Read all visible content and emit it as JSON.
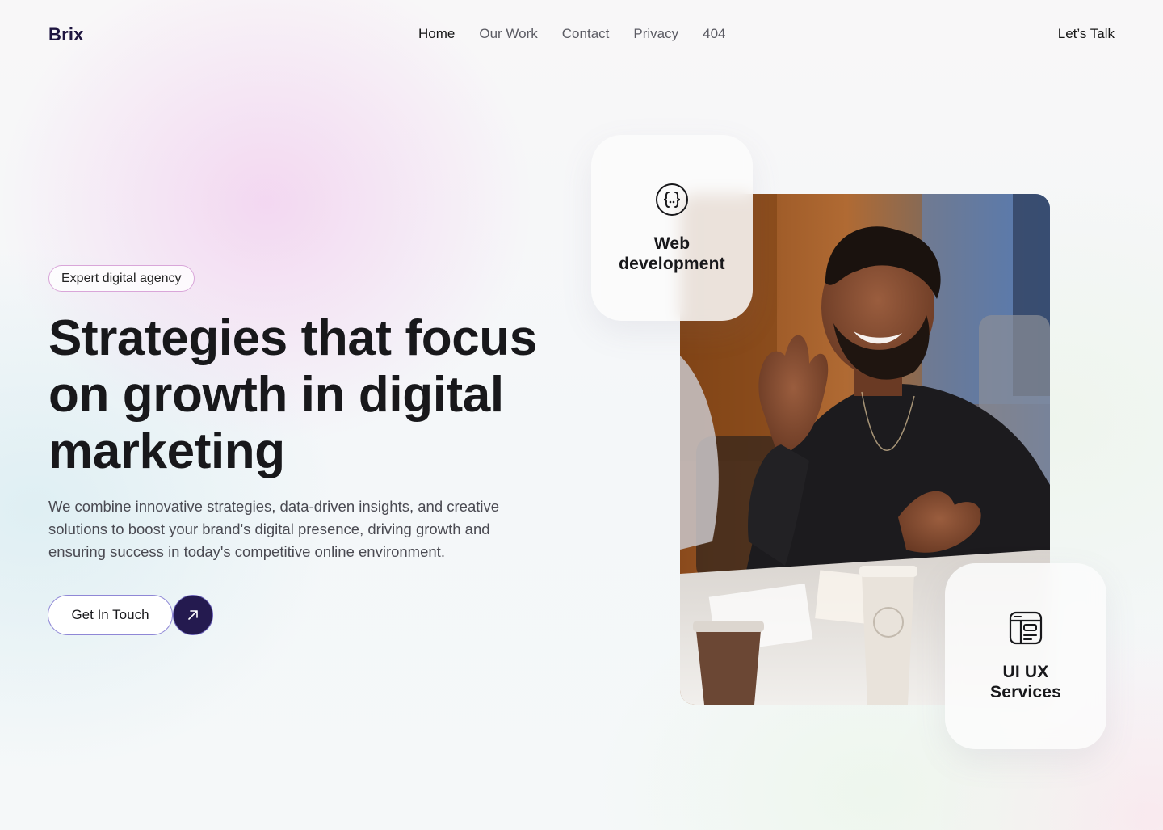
{
  "brand": {
    "name": "Brix"
  },
  "nav": {
    "items": [
      {
        "label": "Home",
        "active": true
      },
      {
        "label": "Our Work",
        "active": false
      },
      {
        "label": "Contact",
        "active": false
      },
      {
        "label": "Privacy",
        "active": false
      },
      {
        "label": "404",
        "active": false
      }
    ],
    "cta": "Let’s Talk"
  },
  "hero": {
    "badge": "Expert digital agency",
    "title_lines": [
      "Strategies that focus",
      "on growth in digital",
      "marketing"
    ],
    "description_lines": [
      "We combine innovative strategies, data-driven insights, and creative",
      "solutions to boost your brand's digital presence, driving growth and",
      "ensuring success in today's competitive online environment."
    ],
    "primary_button": "Get In Touch",
    "arrow_button_icon": "arrow-up-right-icon"
  },
  "cards": [
    {
      "icon": "code-braces-icon",
      "title_lines": [
        "Web",
        "development"
      ]
    },
    {
      "icon": "layout-window-icon",
      "title_lines": [
        "UI UX",
        "Services"
      ]
    }
  ],
  "colors": {
    "brand": "#1e1540",
    "accent_dark": "#241a4f",
    "button_border": "#8f87d6",
    "badge_border": "#d9a6d9",
    "text": "#18181b",
    "muted": "#5b5b63"
  }
}
